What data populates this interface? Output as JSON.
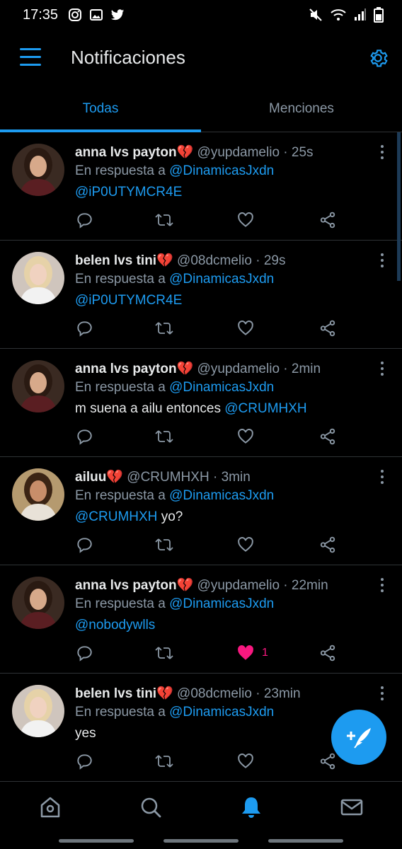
{
  "status_bar": {
    "time": "17:35",
    "left_icons": [
      "instagram-icon",
      "gallery-icon",
      "twitter-icon"
    ],
    "right_icons": [
      "mute-icon",
      "wifi-icon",
      "signal-icon",
      "battery-icon"
    ]
  },
  "header": {
    "title": "Notificaciones",
    "menu_icon": "hamburger-menu-icon",
    "settings_icon": "gear-icon"
  },
  "tabs": [
    {
      "label": "Todas",
      "active": true
    },
    {
      "label": "Menciones",
      "active": false
    }
  ],
  "notifications": [
    {
      "name": "anna lvs payton💔",
      "handle": "@yupdamelio",
      "time": "25s",
      "reply_prefix": "En respuesta a",
      "reply_to": "@DinamicasJxdn",
      "body_text": "",
      "body_mention": "@iP0UTYMCR4E",
      "body_order": "mention-first",
      "liked": false,
      "like_count": ""
    },
    {
      "name": "belen lvs tini💔",
      "handle": "@08dcmelio",
      "time": "29s",
      "reply_prefix": "En respuesta a",
      "reply_to": "@DinamicasJxdn",
      "body_text": "",
      "body_mention": "@iP0UTYMCR4E",
      "body_order": "mention-first",
      "liked": false,
      "like_count": ""
    },
    {
      "name": "anna lvs payton💔",
      "handle": "@yupdamelio",
      "time": "2min",
      "reply_prefix": "En respuesta a",
      "reply_to": "@DinamicasJxdn",
      "body_text": "m suena a ailu entonces",
      "body_mention": "@CRUMHXH",
      "body_order": "text-first",
      "liked": false,
      "like_count": ""
    },
    {
      "name": "ailuu💔",
      "handle": "@CRUMHXH",
      "time": "3min",
      "reply_prefix": "En respuesta a",
      "reply_to": "@DinamicasJxdn",
      "body_text": "yo?",
      "body_mention": "@CRUMHXH",
      "body_order": "mention-first",
      "liked": false,
      "like_count": ""
    },
    {
      "name": "anna lvs payton💔",
      "handle": "@yupdamelio",
      "time": "22min",
      "reply_prefix": "En respuesta a",
      "reply_to": "@DinamicasJxdn",
      "body_text": "",
      "body_mention": "@nobodywlls",
      "body_order": "mention-first",
      "liked": true,
      "like_count": "1"
    },
    {
      "name": "belen lvs tini💔",
      "handle": "@08dcmelio",
      "time": "23min",
      "reply_prefix": "En respuesta a",
      "reply_to": "@DinamicasJxdn",
      "body_text": "yes",
      "body_mention": "",
      "body_order": "text-first",
      "liked": false,
      "like_count": ""
    }
  ],
  "fab": {
    "icon": "compose-tweet-icon"
  },
  "bottom_nav": [
    {
      "icon": "home-icon",
      "active": false
    },
    {
      "icon": "search-icon",
      "active": false
    },
    {
      "icon": "bell-icon",
      "active": true
    },
    {
      "icon": "mail-icon",
      "active": false
    }
  ],
  "colors": {
    "accent": "#1d9bf0",
    "like": "#f91880",
    "muted": "#8b98a5",
    "background": "#000000"
  }
}
